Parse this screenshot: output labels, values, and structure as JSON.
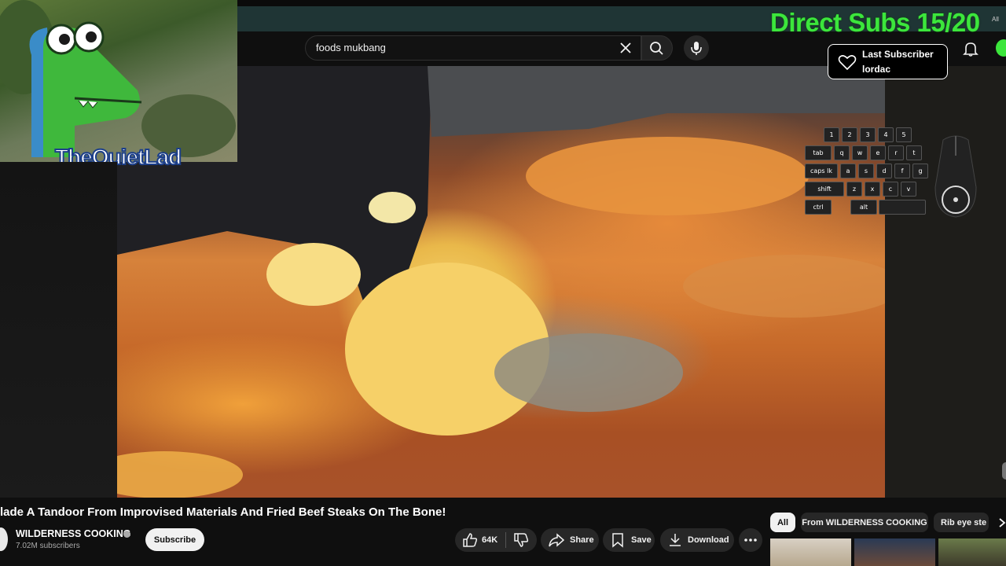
{
  "header": {
    "search_value": "foods mukbang"
  },
  "stream_overlay": {
    "direct_subs_label": "Direct Subs 15/20",
    "corner_text": "All",
    "last_subscriber_label": "Last Subscriber",
    "last_subscriber_name": "lordac",
    "streamer_name": "TheQuietLad",
    "keys": {
      "row1": [
        "1",
        "2",
        "3",
        "4",
        "5"
      ],
      "row2": [
        "tab",
        "q",
        "w",
        "e",
        "r",
        "t"
      ],
      "row3": [
        "caps lk",
        "a",
        "s",
        "d",
        "f",
        "g"
      ],
      "row4": [
        "shift",
        "z",
        "x",
        "c",
        "v"
      ],
      "row5": [
        "ctrl",
        "alt"
      ]
    }
  },
  "video": {
    "title": "lade A Tandoor From Improvised Materials And Fried Beef Steaks On The Bone!",
    "channel_name": "WILDERNESS COOKING",
    "channel_subscribers": "7.02M subscribers",
    "subscribe_label": "Subscribe",
    "like_count": "64K",
    "share_label": "Share",
    "save_label": "Save",
    "download_label": "Download"
  },
  "chips": [
    "All",
    "From WILDERNESS COOKING",
    "Rib eye ste"
  ],
  "colors": {
    "overlay_green": "#3ce63c",
    "background": "#0f0f0f"
  }
}
